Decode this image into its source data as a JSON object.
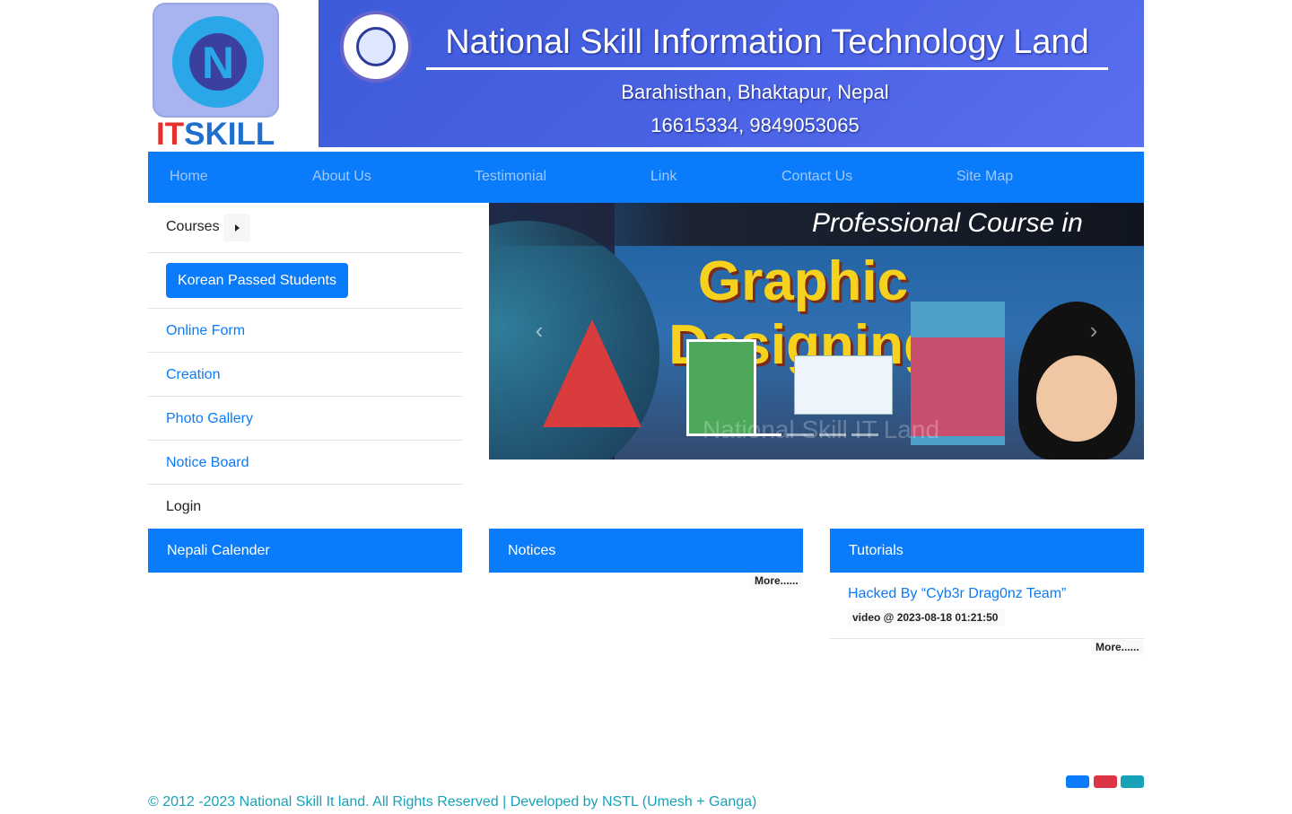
{
  "header": {
    "logo_text_it": "IT",
    "logo_text_skill": "SKILL",
    "banner_title": "National Skill Information Technology Land",
    "banner_address": "Barahisthan, Bhaktapur, Nepal",
    "banner_phone": "16615334, 9849053065"
  },
  "nav": {
    "items": [
      {
        "label": "Home"
      },
      {
        "label": "About Us"
      },
      {
        "label": "Testimonial"
      },
      {
        "label": "Link"
      },
      {
        "label": "Contact Us"
      },
      {
        "label": "Site Map"
      }
    ]
  },
  "sidebar": {
    "courses_label": "Courses",
    "korean_button": "Korean Passed Students",
    "items": [
      {
        "label": "Online Form"
      },
      {
        "label": "Creation"
      },
      {
        "label": "Photo Gallery"
      },
      {
        "label": "Notice Board"
      }
    ],
    "login_label": "Login"
  },
  "slider": {
    "headline_top": "Professional Course in",
    "headline_main": "Graphic Designing",
    "watermark": "National Skill IT Land",
    "prev_label": "Previous",
    "next_label": "Next",
    "indicator_count": 4,
    "active_indicator": 0
  },
  "panels": {
    "calendar_title": "Nepali Calender",
    "notices_title": "Notices",
    "notices_more": "More......",
    "tutorials_title": "Tutorials",
    "tutorial_item_title": "Hacked By “Cyb3r Drag0nz Team”",
    "tutorial_item_meta": "video @ 2023-08-18 01:21:50",
    "tutorials_more": "More......"
  },
  "footer": {
    "copyright": "© 2012 -2023 National Skill It land. All Rights Reserved | Developed by NSTL (Umesh + Ganga)",
    "social_colors": [
      "#0a7bfa",
      "#dc3545",
      "#17a2b8"
    ]
  },
  "colors": {
    "primary": "#0a7bfa",
    "footer_text": "#17a2b8"
  }
}
